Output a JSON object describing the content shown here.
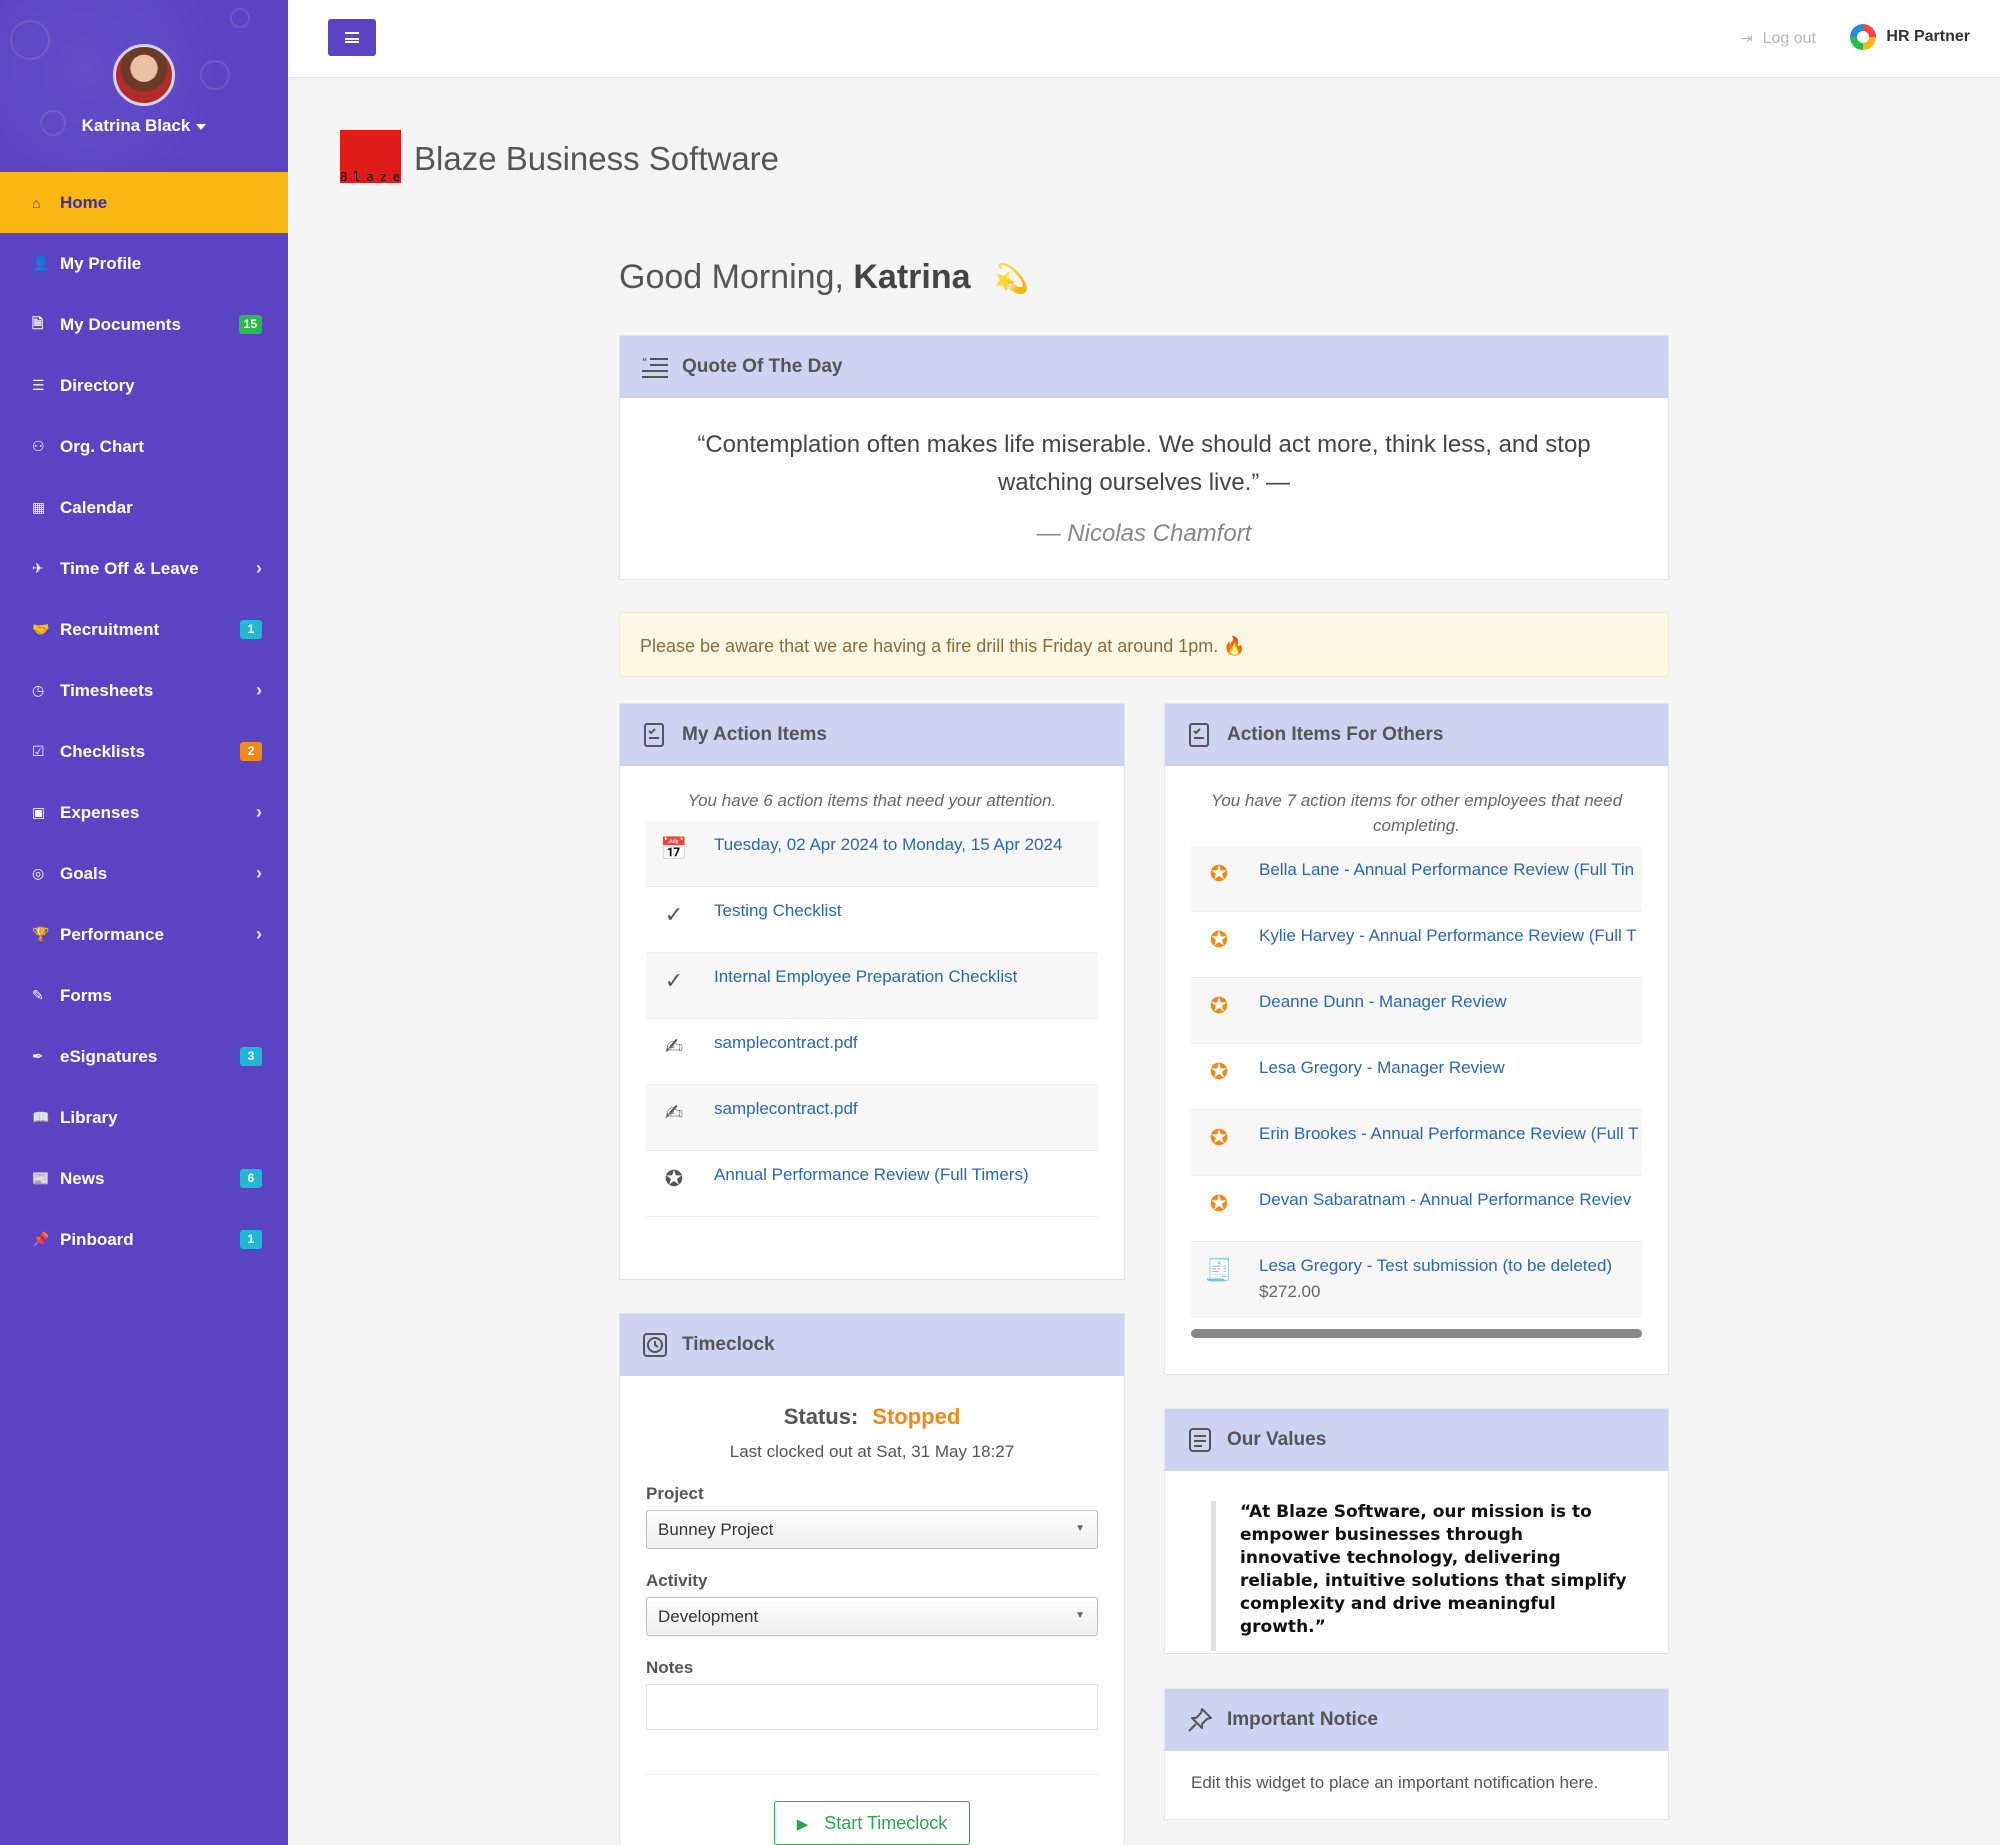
{
  "user": {
    "name": "Katrina Black"
  },
  "sidebar": {
    "items": [
      {
        "label": "Home",
        "icon": "home-icon",
        "glyph": "⌂",
        "active": true
      },
      {
        "label": "My Profile",
        "icon": "user-icon",
        "glyph": "👤"
      },
      {
        "label": "My Documents",
        "icon": "document-icon",
        "glyph": "🗎",
        "badge": "15",
        "badge_color": "#2ab94a"
      },
      {
        "label": "Directory",
        "icon": "list-icon",
        "glyph": "☰"
      },
      {
        "label": "Org. Chart",
        "icon": "sitemap-icon",
        "glyph": "⚇"
      },
      {
        "label": "Calendar",
        "icon": "calendar-icon",
        "glyph": "▦"
      },
      {
        "label": "Time Off & Leave",
        "icon": "plane-icon",
        "glyph": "✈",
        "chevron": true
      },
      {
        "label": "Recruitment",
        "icon": "handshake-icon",
        "glyph": "🤝",
        "badge": "1",
        "badge_color": "#1fb9d6"
      },
      {
        "label": "Timesheets",
        "icon": "clock-icon",
        "glyph": "◷",
        "chevron": true
      },
      {
        "label": "Checklists",
        "icon": "checkbox-icon",
        "glyph": "☑",
        "badge": "2",
        "badge_color": "#f0891a"
      },
      {
        "label": "Expenses",
        "icon": "money-icon",
        "glyph": "▣",
        "chevron": true
      },
      {
        "label": "Goals",
        "icon": "target-icon",
        "glyph": "◎",
        "chevron": true
      },
      {
        "label": "Performance",
        "icon": "trophy-icon",
        "glyph": "🏆",
        "chevron": true
      },
      {
        "label": "Forms",
        "icon": "edit-icon",
        "glyph": "✎"
      },
      {
        "label": "eSignatures",
        "icon": "pen-icon",
        "glyph": "✒",
        "badge": "3",
        "badge_color": "#1fb9d6"
      },
      {
        "label": "Library",
        "icon": "book-icon",
        "glyph": "📖"
      },
      {
        "label": "News",
        "icon": "newspaper-icon",
        "glyph": "📰",
        "badge": "6",
        "badge_color": "#1fb9d6"
      },
      {
        "label": "Pinboard",
        "icon": "pin-icon",
        "glyph": "📌",
        "badge": "1",
        "badge_color": "#1fb9d6"
      }
    ]
  },
  "topbar": {
    "logout": "Log out",
    "brand": "HR Partner"
  },
  "company": {
    "name": "Blaze Business Software",
    "logo_text": "Blaze"
  },
  "greeting": {
    "prefix": "Good Morning,",
    "name": "Katrina",
    "emoji": "💫"
  },
  "quote": {
    "title": "Quote Of The Day",
    "text": "“Contemplation often makes life miserable. We should act more, think less, and stop watching ourselves live.” —",
    "author": "— Nicolas Chamfort"
  },
  "notice": {
    "text": "Please be aware that we are having a fire drill this Friday at around 1pm. 🔥"
  },
  "my_actions": {
    "title": "My Action Items",
    "info": "You have 6 action items that need your attention.",
    "items": [
      {
        "text": "Tuesday, 02 Apr 2024 to Monday, 15 Apr 2024",
        "icon": "calendar-clock-icon",
        "glyph": "📅"
      },
      {
        "text": "Testing Checklist",
        "icon": "check-icon",
        "glyph": "✓"
      },
      {
        "text": "Internal Employee Preparation Checklist",
        "icon": "check-icon",
        "glyph": "✓"
      },
      {
        "text": "samplecontract.pdf",
        "icon": "signature-icon",
        "glyph": "✍"
      },
      {
        "text": "samplecontract.pdf",
        "icon": "signature-icon",
        "glyph": "✍"
      },
      {
        "text": "Annual Performance Review (Full Timers)",
        "icon": "award-icon",
        "glyph": "✪"
      }
    ]
  },
  "others": {
    "title": "Action Items For Others",
    "info": "You have 7 action items for other employees that need completing.",
    "items": [
      {
        "text": "Bella Lane - Annual Performance Review (Full Tin",
        "icon": "award-icon",
        "glyph": "✪"
      },
      {
        "text": "Kylie Harvey - Annual Performance Review (Full T",
        "icon": "award-icon",
        "glyph": "✪"
      },
      {
        "text": "Deanne Dunn - Manager Review",
        "icon": "award-icon",
        "glyph": "✪"
      },
      {
        "text": "Lesa Gregory - Manager Review",
        "icon": "award-icon",
        "glyph": "✪"
      },
      {
        "text": "Erin Brookes - Annual Performance Review (Full T",
        "icon": "award-icon",
        "glyph": "✪"
      },
      {
        "text": "Devan Sabaratnam - Annual Performance Reviev",
        "icon": "award-icon",
        "glyph": "✪"
      },
      {
        "text": "Lesa Gregory - Test submission (to be deleted)",
        "sub": "$272.00",
        "icon": "receipt-icon",
        "glyph": "🧾"
      }
    ]
  },
  "timeclock": {
    "title": "Timeclock",
    "status_label": "Status:",
    "status_value": "Stopped",
    "last": "Last clocked out at Sat, 31 May 18:27",
    "project_label": "Project",
    "project_value": "Bunney Project",
    "activity_label": "Activity",
    "activity_value": "Development",
    "notes_label": "Notes",
    "start_label": "Start Timeclock"
  },
  "values": {
    "title": "Our Values",
    "text": "“At Blaze Software, our mission is to empower businesses through innovative technology, delivering reliable, intuitive solutions that simplify complexity and drive meaningful growth.”"
  },
  "important": {
    "title": "Important Notice",
    "text": "Edit this widget to place an important notification here."
  },
  "colors": {
    "sidebar": "#5a44c4",
    "active": "#fbb714",
    "panel_head": "#d0d2f2",
    "link": "#2a67b1",
    "orange": "#f0891a"
  }
}
